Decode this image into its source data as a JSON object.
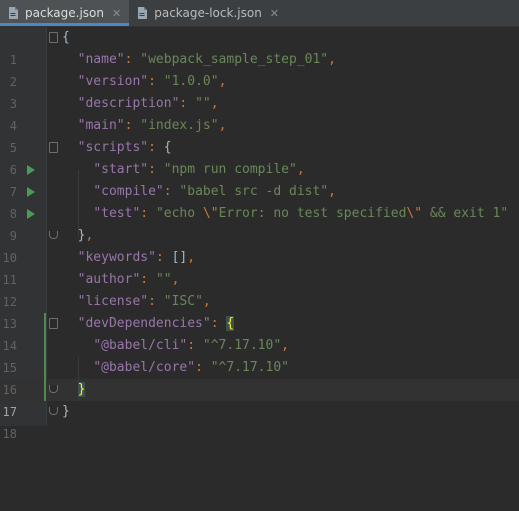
{
  "tabs": [
    {
      "label": "package.json",
      "active": true,
      "icon": "json-file-icon"
    },
    {
      "label": "package-lock.json",
      "active": false,
      "icon": "json-file-icon"
    }
  ],
  "tab_close": "✕",
  "line_numbers": [
    "1",
    "2",
    "3",
    "4",
    "5",
    "6",
    "7",
    "8",
    "9",
    "10",
    "11",
    "12",
    "13",
    "14",
    "15",
    "16",
    "17",
    "18"
  ],
  "current_line": "17",
  "colors": {
    "key": "#9876aa",
    "string": "#6a8759",
    "punctuation": "#cc7832",
    "text": "#a9b7c6",
    "run": "#499c54"
  },
  "code": {
    "l1_open": "{",
    "name_key": "\"name\"",
    "name_val": "\"webpack_sample_step_01\"",
    "version_key": "\"version\"",
    "version_val": "\"1.0.0\"",
    "description_key": "\"description\"",
    "description_val": "\"\"",
    "main_key": "\"main\"",
    "main_val": "\"index.js\"",
    "scripts_key": "\"scripts\"",
    "scripts_open": "{",
    "start_key": "\"start\"",
    "start_val": "\"npm run compile\"",
    "compile_key": "\"compile\"",
    "compile_val": "\"babel src -d dist\"",
    "test_key": "\"test\"",
    "test_val_a": "\"echo ",
    "test_esc1": "\\\"",
    "test_val_b": "Error: no test specified",
    "test_esc2": "\\\"",
    "test_val_c": " && exit 1\"",
    "scripts_close": "}",
    "keywords_key": "\"keywords\"",
    "keywords_val": "[]",
    "author_key": "\"author\"",
    "author_val": "\"\"",
    "license_key": "\"license\"",
    "license_val": "\"ISC\"",
    "devdeps_key": "\"devDependencies\"",
    "devdeps_open": "{",
    "cli_key": "\"@babel/cli\"",
    "cli_val": "\"^7.17.10\"",
    "core_key": "\"@babel/core\"",
    "core_val": "\"^7.17.10\"",
    "devdeps_close": "}",
    "l18_close": "}",
    "colon": ": ",
    "comma": ","
  }
}
